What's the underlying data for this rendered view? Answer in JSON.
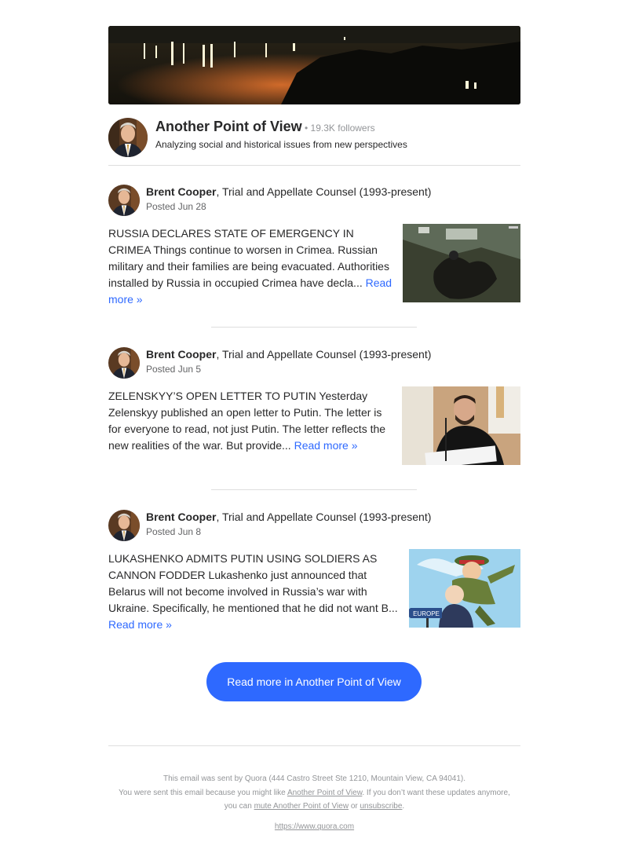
{
  "space": {
    "name": "Another Point of View",
    "followers": " • 19.3K followers",
    "description": "Analyzing social and historical issues from new perspectives"
  },
  "posts": [
    {
      "author": "Brent Cooper",
      "credential": ", Trial and Appellate Counsel (1993-present)",
      "posted": "Posted Jun 28",
      "excerpt": "RUSSIA DECLARES STATE OF EMERGENCY IN CRIMEA Things continue to worsen in Crimea. Russian military and their families are being evacuated. Authorities installed by Russia in occupied Crimea have decla... ",
      "read_more": "Read more »"
    },
    {
      "author": "Brent Cooper",
      "credential": ", Trial and Appellate Counsel (1993-present)",
      "posted": "Posted Jun 5",
      "excerpt": "ZELENSKYY’S OPEN LETTER TO PUTIN Yesterday Zelenskyy published an open letter to Putin. The letter is for everyone to read, not just Putin. The letter reflects the new realities of the war. But provide... ",
      "read_more": "Read more »"
    },
    {
      "author": "Brent Cooper",
      "credential": ", Trial and Appellate Counsel (1993-present)",
      "posted": "Posted Jun 8",
      "excerpt": "LUKASHENKO ADMITS PUTIN USING SOLDIERS AS CANNON FODDER Lukashenko just announced that Belarus will not become involved in Russia’s war with Ukraine. Specifically, he mentioned that he did not want B... ",
      "read_more": "Read more »",
      "image_text": "EUROPE"
    }
  ],
  "cta": {
    "label": "Read more in Another Point of View"
  },
  "footer": {
    "line1": "This email was sent by Quora (444 Castro Street Ste 1210, Mountain View, CA 94041).",
    "line2_pre": "You were sent this email because you might like ",
    "line2_link": "Another Point of View",
    "line2_post": ". If you don’t want these updates anymore,",
    "line3_pre": "you can ",
    "mute_link": "mute Another Point of View",
    "line3_mid": " or ",
    "unsubscribe_link": "unsubscribe",
    "line3_post": ".",
    "url": "https://www.quora.com"
  },
  "colors": {
    "link": "#2e69ff",
    "cta_bg": "#2e69ff",
    "divider": "#dedede",
    "muted": "#939598"
  }
}
